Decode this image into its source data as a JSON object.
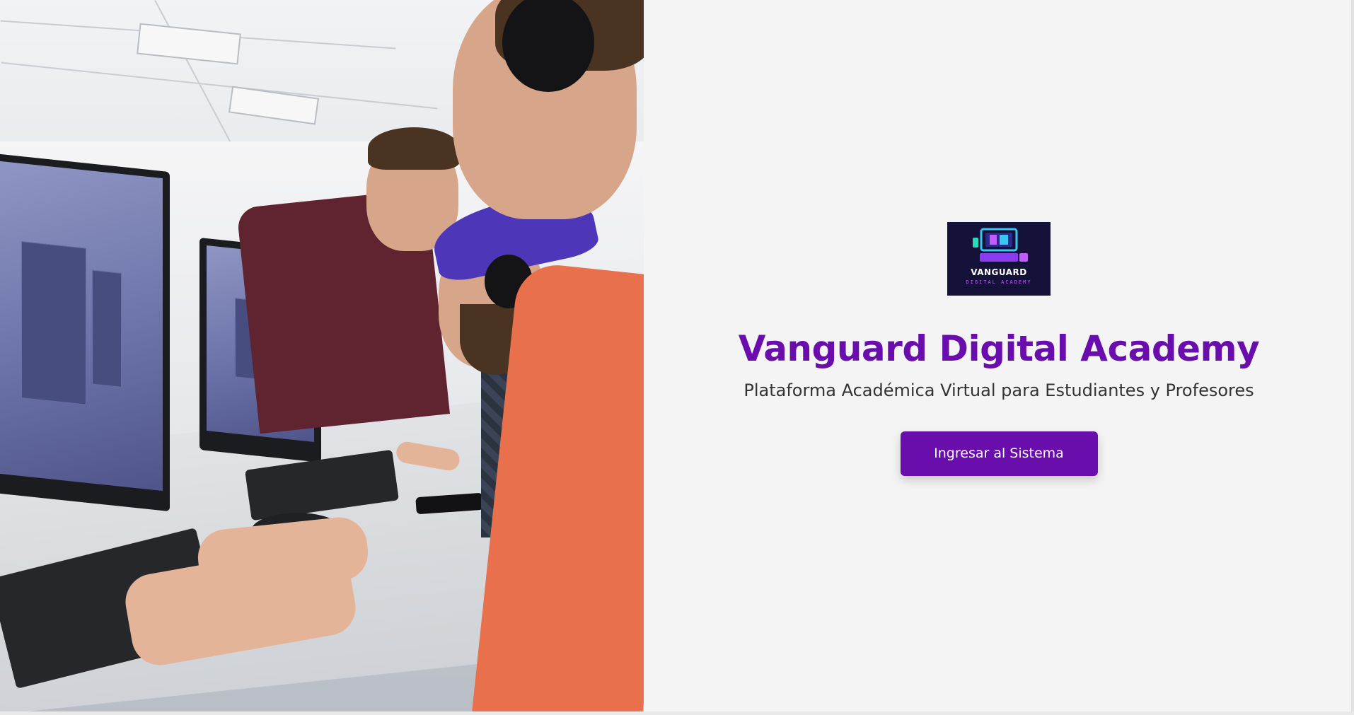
{
  "hero_image": {
    "subject": "students-at-computers-photo"
  },
  "logo": {
    "wordmark": "VANGUARD",
    "tagline": "DIGITAL ACADEMY",
    "bg_color": "#15123a"
  },
  "main": {
    "title": "Vanguard Digital Academy",
    "subtitle": "Plataforma Académica Virtual para Estudiantes y Profesores",
    "cta_label": "Ingresar al Sistema"
  },
  "colors": {
    "accent": "#6a0dad",
    "background": "#f4f4f4",
    "text": "#333333"
  }
}
